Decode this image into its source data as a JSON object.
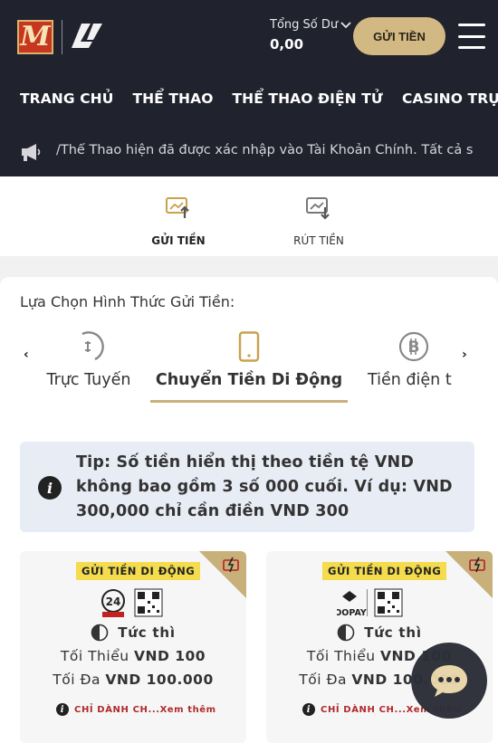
{
  "header": {
    "logo_letter": "M",
    "balance_label": "Tổng Số Dư",
    "balance_value": "0,00",
    "deposit_button": "GỬI TIỀN",
    "nav": [
      "TRANG CHỦ",
      "THỂ THAO",
      "THỂ THAO ĐIỆN TỬ",
      "CASINO TRỰC TUYẾN"
    ],
    "ticker": "/Thể Thao hiện đã được xác nhập vào Tài Khoản Chính. Tất cả số"
  },
  "actions": [
    {
      "label": "GỬI TIỀN",
      "icon": "deposit-icon",
      "active": true
    },
    {
      "label": "RÚT TIỀN",
      "icon": "withdraw-icon",
      "active": false
    }
  ],
  "methods": {
    "title": "Lựa Chọn Hình Thức Gửi Tiền:",
    "items": [
      {
        "label": "Trực Tuyến",
        "icon": "online-bank-icon"
      },
      {
        "label": "Chuyển Tiền Di Động",
        "icon": "mobile-phone-icon",
        "active": true
      },
      {
        "label": "Tiền điện t",
        "icon": "bitcoin-icon"
      }
    ]
  },
  "tip": {
    "text": "Tip: Số tiền hiển thị theo tiền tệ VND không bao gồm 3 số 000 cuối. Ví dụ: VND 300,000 chỉ cần điền VND 300"
  },
  "options": [
    {
      "badge": "GỬI TIỀN DI ĐỘNG",
      "provider": "24h Viet Pay",
      "speed": "Tức thì",
      "min_label": "Tối Thiểu",
      "min_value": "VND 100",
      "max_label": "Tối Đa",
      "max_value": "VND 100.000",
      "note": "CHỈ DÀNH CH...Xem thêm"
    },
    {
      "badge": "GỬI TIỀN DI ĐỘNG",
      "provider": "OOPAY",
      "speed": "Tức thì",
      "min_label": "Tối Thiểu",
      "min_value": "VND 100",
      "max_label": "Tối Đa",
      "max_value": "VND 100.000",
      "note": "CHỈ DÀNH CH...Xem thêm"
    }
  ],
  "colors": {
    "header_bg": "#20222e",
    "gold": "#d2b883",
    "badge_yellow": "#f4dc4e",
    "note_red": "#b12929"
  }
}
